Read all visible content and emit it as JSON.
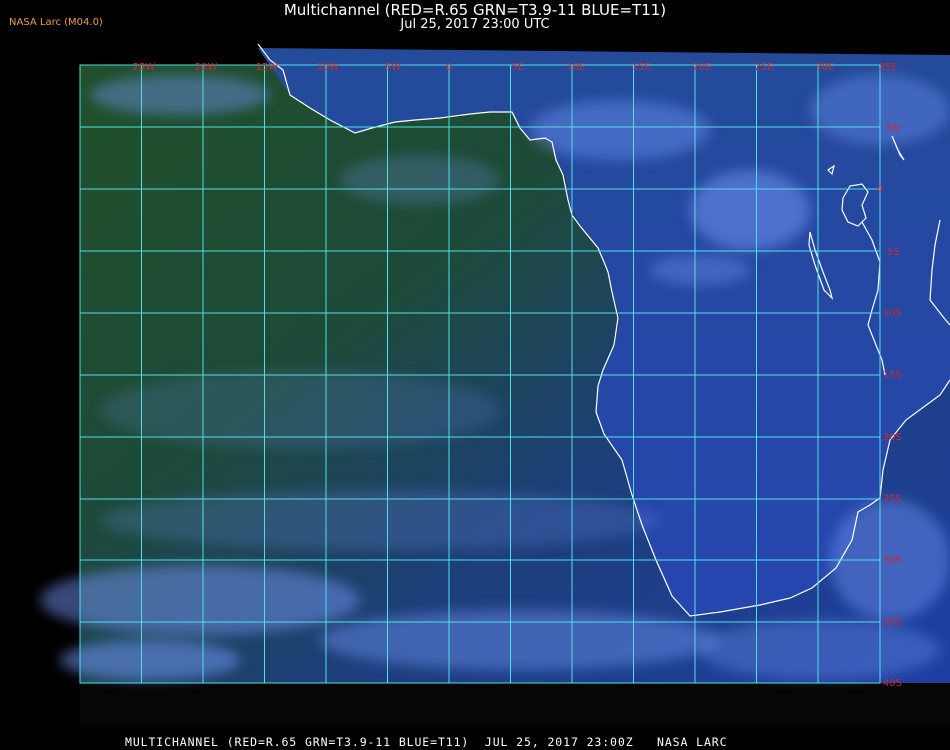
{
  "header": {
    "badge": "NASA Larc (M04.0)",
    "title": "Multichannel (RED=R.65 GRN=T3.9-11 BLUE=T11)",
    "subtitle": "Jul 25, 2017 23:00 UTC"
  },
  "footer": {
    "caption": "MULTICHANNEL (RED=R.65 GRN=T3.9-11 BLUE=T11)  JUL 25, 2017 23:00Z   NASA LARC"
  },
  "map": {
    "longitude_labels": [
      "25W",
      "20W",
      "15W",
      "10W",
      "5W",
      "0",
      "5E",
      "10E",
      "15E",
      "20E",
      "25E",
      "30E",
      "35E"
    ],
    "latitude_labels": [
      "5N",
      "0",
      "5S",
      "10S",
      "15S",
      "20S",
      "25S",
      "30S",
      "35S",
      "40S"
    ],
    "colors": {
      "grid": "#4fe0e6",
      "grid_labels": "#cc2a2a",
      "coastline": "#ffffff",
      "ocean_green": "#1f4d1e",
      "ocean_blue": "#1e3c9a",
      "cloud": "#6f92f0"
    }
  }
}
